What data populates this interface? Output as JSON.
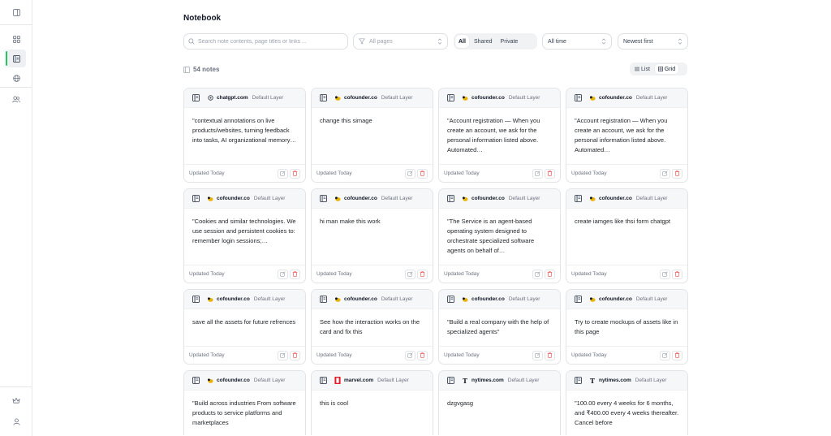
{
  "sidebar": {
    "items": [
      {
        "name": "panel-toggle-icon"
      },
      {
        "name": "dashboard-icon"
      },
      {
        "name": "notebook-icon",
        "active": true
      },
      {
        "name": "globe-icon"
      },
      {
        "name": "users-icon"
      }
    ],
    "bottom": [
      {
        "name": "crown-icon"
      },
      {
        "name": "user-icon"
      }
    ]
  },
  "header": {
    "title": "Notebook"
  },
  "filters": {
    "search_placeholder": "Search note contents, page titles or links ...",
    "pages_placeholder": "All pages",
    "scope_tabs": [
      {
        "label": "All",
        "active": true
      },
      {
        "label": "Shared",
        "active": false
      },
      {
        "label": "Private",
        "active": false
      }
    ],
    "time": "All time",
    "sort": "Newest first"
  },
  "summary": {
    "count": "54 notes"
  },
  "view_toggle": {
    "list": "List",
    "grid": "Grid",
    "active": "grid"
  },
  "colors": {
    "accent": "#22c55e",
    "delete": "#ef4444",
    "cofounder_icon": "#eab308",
    "marvel_icon": "#e11d2a"
  },
  "notes": [
    {
      "domain": "chatgpt.com",
      "icon": "chatgpt-icon",
      "layer": "Default Layer",
      "body": "\"contextual annotations on live products/websites, turning feedback into tasks, AI organizational memory…",
      "updated": "Updated Today"
    },
    {
      "domain": "cofounder.co",
      "icon": "cofounder-icon",
      "layer": "Default Layer",
      "body": "change this simage",
      "updated": "Updated Today"
    },
    {
      "domain": "cofounder.co",
      "icon": "cofounder-icon",
      "layer": "Default Layer",
      "body": "\"Account registration — When you create an account, we ask for the personal information listed above. Automated…",
      "updated": "Updated Today"
    },
    {
      "domain": "cofounder.co",
      "icon": "cofounder-icon",
      "layer": "Default Layer",
      "body": "\"Account registration — When you create an account, we ask for the personal information listed above. Automated…",
      "updated": "Updated Today"
    },
    {
      "domain": "cofounder.co",
      "icon": "cofounder-icon",
      "layer": "Default Layer",
      "body": "\"Cookies and similar technologies. We use session and persistent cookies to: remember login sessions;…",
      "updated": "Updated Today"
    },
    {
      "domain": "cofounder.co",
      "icon": "cofounder-icon",
      "layer": "Default Layer",
      "body": "hi man make this work",
      "updated": "Updated Today"
    },
    {
      "domain": "cofounder.co",
      "icon": "cofounder-icon",
      "layer": "Default Layer",
      "body": "\"The Service is an agent-based operating system designed to orchestrate specialized software agents on behalf of…",
      "updated": "Updated Today"
    },
    {
      "domain": "cofounder.co",
      "icon": "cofounder-icon",
      "layer": "Default Layer",
      "body": "create iamges like thsi form chatgpt",
      "updated": "Updated Today"
    },
    {
      "domain": "cofounder.co",
      "icon": "cofounder-icon",
      "layer": "Default Layer",
      "body": "save all the assets for future refrences",
      "updated": "Updated Today"
    },
    {
      "domain": "cofounder.co",
      "icon": "cofounder-icon",
      "layer": "Default Layer",
      "body": "See how the interaction works on the card and fix this",
      "updated": "Updated Today"
    },
    {
      "domain": "cofounder.co",
      "icon": "cofounder-icon",
      "layer": "Default Layer",
      "body": "\"Build a real company with the help of specialized agents\"",
      "updated": "Updated Today"
    },
    {
      "domain": "cofounder.co",
      "icon": "cofounder-icon",
      "layer": "Default Layer",
      "body": "Try to create mockups of assets like in this page",
      "updated": "Updated Today"
    },
    {
      "domain": "cofounder.co",
      "icon": "cofounder-icon",
      "layer": "Default Layer",
      "body": "\"Build across industries From software products to service platforms and marketplaces",
      "updated": ""
    },
    {
      "domain": "marvel.com",
      "icon": "marvel-icon",
      "layer": "Default Layer",
      "body": "this is cool",
      "updated": ""
    },
    {
      "domain": "nytimes.com",
      "icon": "nytimes-icon",
      "layer": "Default Layer",
      "body": "dzgvgasg",
      "updated": ""
    },
    {
      "domain": "nytimes.com",
      "icon": "nytimes-icon",
      "layer": "Default Layer",
      "body": "\"100.00 every 4 weeks for 6 months, and ₹400.00 every 4 weeks thereafter. Cancel before",
      "updated": ""
    }
  ]
}
